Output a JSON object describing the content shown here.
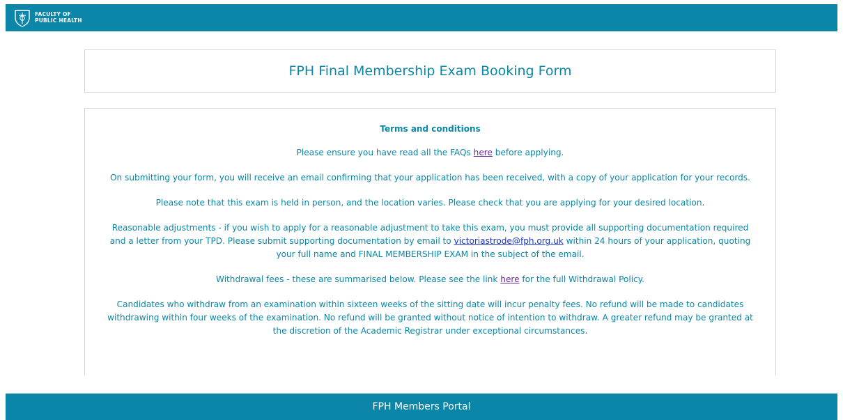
{
  "header": {
    "logo_line1": "FACULTY OF",
    "logo_line2": "PUBLIC HEALTH"
  },
  "form": {
    "title": "FPH Final Membership Exam Booking Form"
  },
  "terms": {
    "heading": "Terms and conditions",
    "faq_before": "Please ensure you have read all the FAQs ",
    "faq_link": "here",
    "faq_after": " before applying.",
    "submit_note": "On submitting your form, you will receive an email confirming that your application has been received, with a copy of your application for your records.",
    "location_note": "Please note that this exam is held in person, and the location varies. Please check that you are applying for your desired location.",
    "adjust_before": "Reasonable adjustments - if you wish to apply for a reasonable adjustment to take this exam, you must provide all supporting documentation required and a letter from your TPD. Please submit supporting documentation by email to ",
    "adjust_email": "victoriastrode@fph.org.uk",
    "adjust_after": " within 24 hours of your application, quoting your full name and FINAL MEMBERSHIP EXAM in the subject of the email.",
    "withdraw_before": "Withdrawal fees - these are summarised below. Please see the link ",
    "withdraw_link": "here",
    "withdraw_after": " for the full Withdrawal Policy.",
    "penalty_note": "Candidates who withdraw from an examination within sixteen weeks of the sitting date will incur penalty fees. No refund will be made to candidates withdrawing within four weeks of the examination. No refund will be granted without notice of intention to withdraw. A greater refund may be granted at the discretion of the Academic Registrar under exceptional circumstances."
  },
  "footer": {
    "label": "FPH Members Portal"
  },
  "colors": {
    "brand": "#0b86a8",
    "text_accent": "#0a86a6",
    "visited_link": "#6a2aa0",
    "email_link": "#1b33c0"
  }
}
